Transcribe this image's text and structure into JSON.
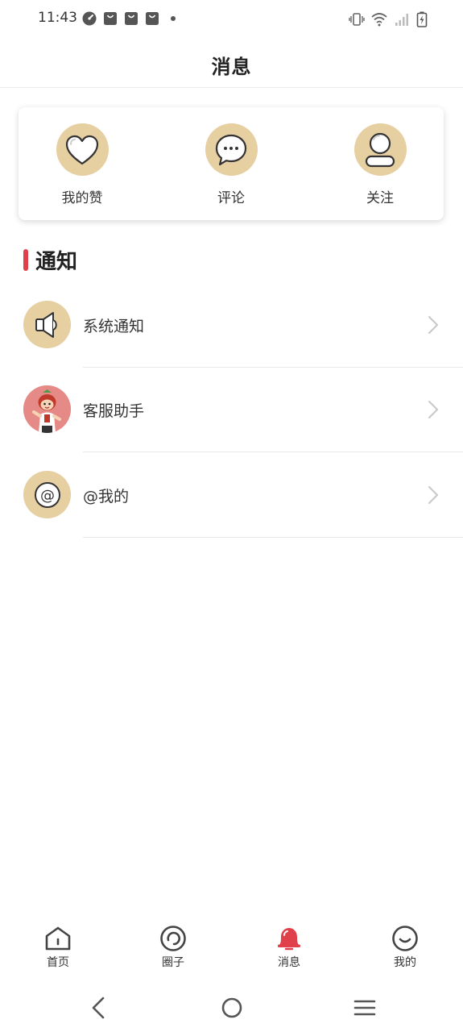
{
  "status_bar": {
    "time": "11:43",
    "left_icons": [
      "speedometer-icon",
      "shopping-bag-icon",
      "shopping-bag-icon",
      "shopping-bag-icon",
      "dot-icon"
    ],
    "right_icons": [
      "vibrate-icon",
      "wifi-icon",
      "signal-icon",
      "battery-charging-icon"
    ]
  },
  "header": {
    "title": "消息"
  },
  "quick_actions": [
    {
      "label": "我的赞",
      "icon": "heart-icon"
    },
    {
      "label": "评论",
      "icon": "comment-bubble-icon"
    },
    {
      "label": "关注",
      "icon": "user-icon"
    }
  ],
  "section": {
    "title": "通知"
  },
  "notifications": [
    {
      "label": "系统通知",
      "icon": "speaker-icon"
    },
    {
      "label": "客服助手",
      "icon": "service-mascot-avatar"
    },
    {
      "label": "@我的",
      "icon": "at-sign-icon"
    }
  ],
  "bottom_nav": {
    "items": [
      {
        "label": "首页",
        "icon": "home-icon",
        "active": false
      },
      {
        "label": "圈子",
        "icon": "circle-refresh-icon",
        "active": false
      },
      {
        "label": "消息",
        "icon": "bell-icon",
        "active": true
      },
      {
        "label": "我的",
        "icon": "smile-face-icon",
        "active": false
      }
    ]
  },
  "colors": {
    "accent_red": "#e0404a",
    "icon_bg_tan": "#e6cfa1",
    "avatar_bg_pink": "#e58a86"
  }
}
